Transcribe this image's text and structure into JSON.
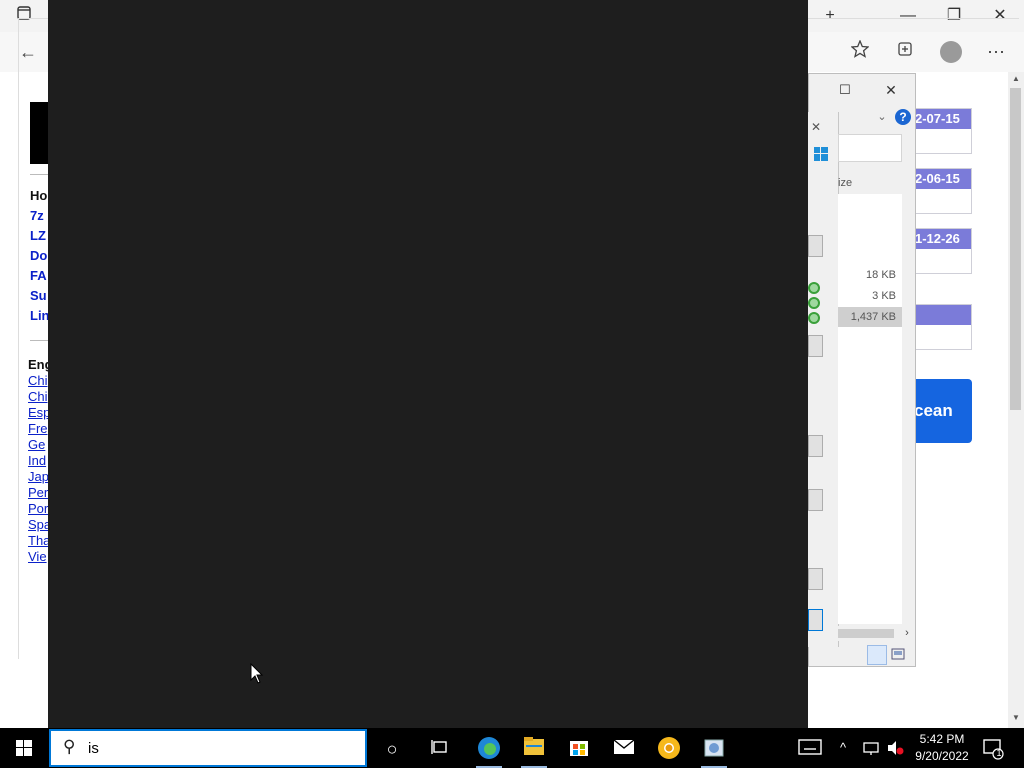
{
  "browser": {
    "new_tab_symbol": "+",
    "minimize_symbol": "—",
    "restore_symbol": "❐",
    "close_symbol": "✕",
    "back_symbol": "←",
    "more_symbol": "⋯"
  },
  "webpage": {
    "nav_links": [
      "Ho",
      "7z",
      "LZ",
      "Do",
      "FA",
      "Su",
      "Lin"
    ],
    "lang_heading": "Eng",
    "lang_links": [
      "Chi",
      "Chi",
      "Esp",
      "Fre",
      "Ge",
      "Ind",
      "Jap",
      "Per",
      "Por",
      "Spa",
      "Tha",
      "Vie"
    ],
    "date_cards": [
      "2-07-15",
      "2-06-15",
      "1-12-26"
    ],
    "ocean_button": "cean"
  },
  "dialog": {
    "column_header": "ize",
    "file_sizes": [
      "18 KB",
      "3 KB",
      "1,437 KB"
    ],
    "help_symbol": "?"
  },
  "taskbar": {
    "search_value": "is",
    "search_glass": "⚲",
    "cortana_symbol": "○",
    "clock_time": "5:42 PM",
    "clock_date": "9/20/2022",
    "notification_count": "1"
  }
}
